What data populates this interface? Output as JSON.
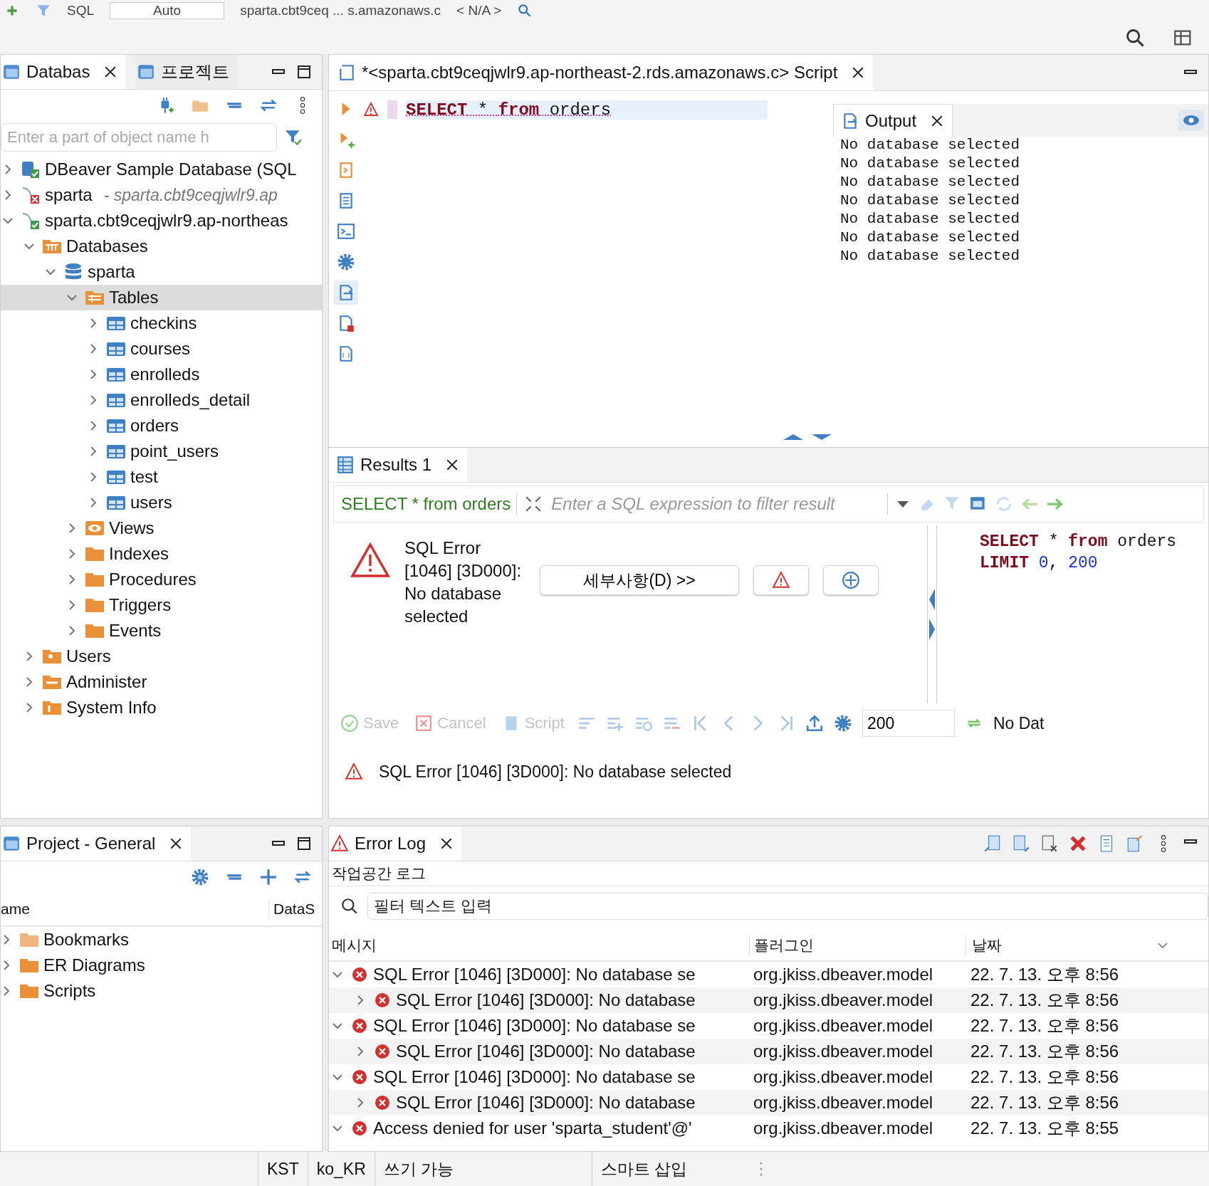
{
  "toolbar": {
    "items": [
      "SQL",
      "Auto",
      "sparta.cbt9ceq ... s.amazonaws.c",
      "< N/A >"
    ]
  },
  "navigator": {
    "tabs": [
      {
        "label": "Databas",
        "selected": true
      },
      {
        "label": "프로젝트",
        "selected": false
      }
    ],
    "search": {
      "placeholder": "Enter a part of object name h"
    },
    "tree": [
      {
        "label": "DBeaver Sample Database (SQL",
        "kind": "sample",
        "connected": true,
        "expanded": false,
        "selected": false
      },
      {
        "label": "sparta",
        "detail": "- sparta.cbt9ceqjwlr9.ap",
        "kind": "mysql",
        "connected": false,
        "expanded": false,
        "selected": false
      },
      {
        "label": "sparta.cbt9ceqjwlr9.ap-northeas",
        "kind": "mysql",
        "connected": true,
        "expanded": true,
        "selected": false,
        "children": [
          {
            "label": "Databases",
            "kind": "databases",
            "expanded": true,
            "selected": false,
            "children": [
              {
                "label": "sparta",
                "kind": "database",
                "expanded": true,
                "selected": false,
                "children": [
                  {
                    "label": "Tables",
                    "kind": "tables",
                    "expanded": true,
                    "selected": true,
                    "children": [
                      {
                        "label": "checkins",
                        "kind": "table",
                        "expanded": false,
                        "selected": false
                      },
                      {
                        "label": "courses",
                        "kind": "table",
                        "expanded": false,
                        "selected": false
                      },
                      {
                        "label": "enrolleds",
                        "kind": "table",
                        "expanded": false,
                        "selected": false
                      },
                      {
                        "label": "enrolleds_detail",
                        "kind": "table",
                        "expanded": false,
                        "selected": false
                      },
                      {
                        "label": "orders",
                        "kind": "table",
                        "expanded": false,
                        "selected": false
                      },
                      {
                        "label": "point_users",
                        "kind": "table",
                        "expanded": false,
                        "selected": false
                      },
                      {
                        "label": "test",
                        "kind": "table",
                        "expanded": false,
                        "selected": false
                      },
                      {
                        "label": "users",
                        "kind": "table",
                        "expanded": false,
                        "selected": false
                      }
                    ]
                  },
                  {
                    "label": "Views",
                    "kind": "views",
                    "expanded": false,
                    "selected": false
                  },
                  {
                    "label": "Indexes",
                    "kind": "folder",
                    "expanded": false,
                    "selected": false
                  },
                  {
                    "label": "Procedures",
                    "kind": "folder",
                    "expanded": false,
                    "selected": false
                  },
                  {
                    "label": "Triggers",
                    "kind": "folder",
                    "expanded": false,
                    "selected": false
                  },
                  {
                    "label": "Events",
                    "kind": "folder",
                    "expanded": false,
                    "selected": false
                  }
                ]
              }
            ]
          },
          {
            "label": "Users",
            "kind": "users",
            "expanded": false,
            "selected": false
          },
          {
            "label": "Administer",
            "kind": "admin",
            "expanded": false,
            "selected": false
          },
          {
            "label": "System Info",
            "kind": "info",
            "expanded": false,
            "selected": false
          }
        ]
      }
    ]
  },
  "editor": {
    "tab": {
      "title": "*<sparta.cbt9ceqjwlr9.ap-northeast-2.rds.amazonaws.c> Script"
    },
    "lines": [
      {
        "has_error": true,
        "tokens": [
          {
            "text": "SELECT",
            "kind": "keyword"
          },
          {
            "text": " * ",
            "kind": "plain"
          },
          {
            "text": "from",
            "kind": "keyword"
          },
          {
            "text": " orders",
            "kind": "plain"
          }
        ]
      }
    ],
    "output": {
      "tab": "Output",
      "lines": [
        "No database selected",
        "No database selected",
        "No database selected",
        "No database selected",
        "No database selected",
        "No database selected",
        "No database selected"
      ]
    }
  },
  "results": {
    "tab": "Results 1",
    "query": "SELECT * from orders",
    "filter": {
      "placeholder": "Enter a SQL expression to filter result"
    },
    "error": {
      "message": "SQL Error [1046] [3D000]: No database selected",
      "details_button": "세부사항(D) >>"
    },
    "sql_lines": [
      [
        {
          "text": "SELECT",
          "kind": "keyword"
        },
        {
          "text": " * ",
          "kind": "plain"
        },
        {
          "text": "from",
          "kind": "keyword"
        },
        {
          "text": " orders",
          "kind": "plain"
        }
      ],
      [
        {
          "text": "LIMIT",
          "kind": "keyword"
        },
        {
          "text": " 0",
          "kind": "number"
        },
        {
          "text": ", ",
          "kind": "plain"
        },
        {
          "text": "200",
          "kind": "number"
        }
      ]
    ],
    "actions": [
      {
        "label": "Save",
        "kind": "save",
        "disabled": true
      },
      {
        "label": "Cancel",
        "kind": "cancel",
        "disabled": true
      },
      {
        "label": "Script",
        "kind": "script",
        "disabled": true
      }
    ],
    "fetch_size": "200",
    "refresh_label": "No Dat",
    "status": "SQL Error [1046] [3D000]: No database selected"
  },
  "project": {
    "tab": "Project - General",
    "columns": [
      "ame",
      "DataS"
    ],
    "items": [
      {
        "label": "Bookmarks",
        "kind": "bookmarks",
        "expanded": false
      },
      {
        "label": "ER Diagrams",
        "kind": "diagrams",
        "expanded": false
      },
      {
        "label": "Scripts",
        "kind": "scripts",
        "expanded": false
      }
    ]
  },
  "error_log": {
    "tab": "Error Log",
    "subtitle": "작업공간 로그",
    "filter": {
      "placeholder": "필터 텍스트 입력"
    },
    "columns": [
      "메시지",
      "플러그인",
      "날짜"
    ],
    "rows": [
      {
        "message": "SQL Error [1046] [3D000]: No database se",
        "plugin": "org.jkiss.dbeaver.model",
        "date": "22. 7. 13. 오후 8:56",
        "expanded": true,
        "children": [
          {
            "message": "SQL Error [1046] [3D000]: No database",
            "plugin": "org.jkiss.dbeaver.model",
            "date": "22. 7. 13. 오후 8:56",
            "expanded": false
          }
        ]
      },
      {
        "message": "SQL Error [1046] [3D000]: No database se",
        "plugin": "org.jkiss.dbeaver.model",
        "date": "22. 7. 13. 오후 8:56",
        "expanded": true,
        "children": [
          {
            "message": "SQL Error [1046] [3D000]: No database",
            "plugin": "org.jkiss.dbeaver.model",
            "date": "22. 7. 13. 오후 8:56",
            "expanded": false
          }
        ]
      },
      {
        "message": "SQL Error [1046] [3D000]: No database se",
        "plugin": "org.jkiss.dbeaver.model",
        "date": "22. 7. 13. 오후 8:56",
        "expanded": true,
        "children": [
          {
            "message": "SQL Error [1046] [3D000]: No database",
            "plugin": "org.jkiss.dbeaver.model",
            "date": "22. 7. 13. 오후 8:56",
            "expanded": false
          }
        ]
      },
      {
        "message": "Access denied for user 'sparta_student'@'",
        "plugin": "org.jkiss.dbeaver.model",
        "date": "22. 7. 13. 오후 8:55",
        "expanded": true
      }
    ]
  },
  "status_bar": [
    "KST",
    "ko_KR",
    "쓰기 가능",
    "스마트 삽입"
  ]
}
